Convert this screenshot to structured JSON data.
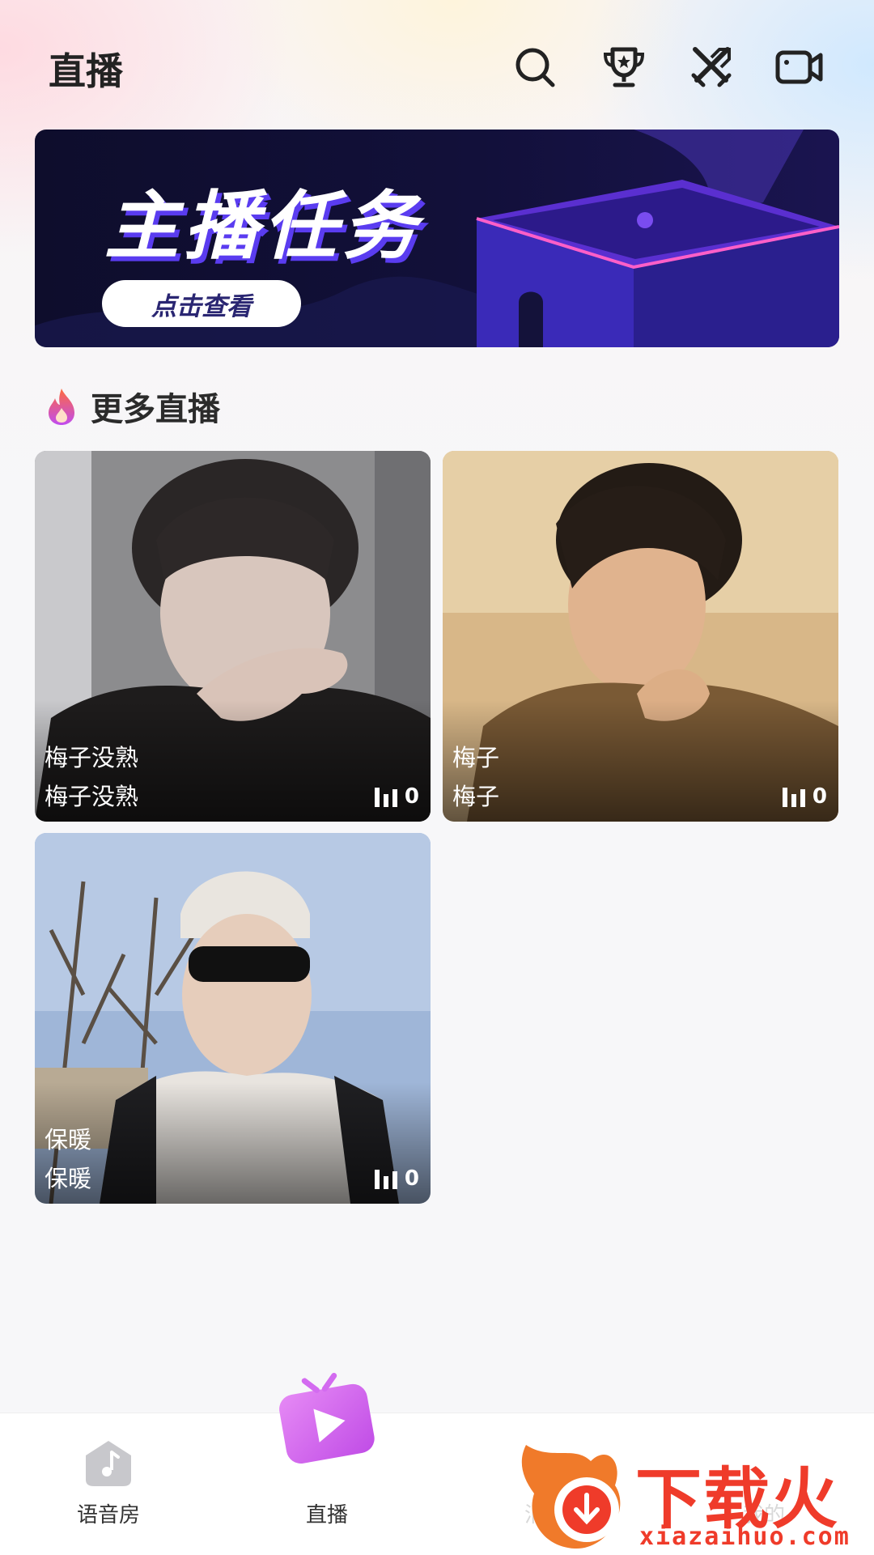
{
  "header": {
    "title": "直播",
    "icons": [
      "search-icon",
      "trophy-icon",
      "pk-swords-icon",
      "video-camera-icon"
    ]
  },
  "banner": {
    "title": "主播任务",
    "button_label": "点击查看"
  },
  "section": {
    "title": "更多直播",
    "icon": "flame-icon"
  },
  "cards": [
    {
      "name": "梅子没熟",
      "subtitle": "梅子没熟",
      "viewers": "0",
      "image": "person-photo-gray-tshirt"
    },
    {
      "name": "梅子",
      "subtitle": "梅子",
      "viewers": "0",
      "image": "person-photo-brown-shirt"
    },
    {
      "name": "保暖",
      "subtitle": "保暖",
      "viewers": "0",
      "image": "person-photo-cap-sunglasses"
    }
  ],
  "tabbar": {
    "tabs": [
      {
        "label": "语音房",
        "icon": "music-note-icon"
      },
      {
        "label": "直播",
        "icon": "tv-play-icon"
      },
      {
        "label": "消息",
        "icon": "message-icon"
      },
      {
        "label": "我的",
        "icon": "profile-icon"
      }
    ]
  },
  "watermark": {
    "text": "下载火",
    "url": "xiazaihuo.com"
  },
  "colors": {
    "accent": "#d86cf0",
    "banner_bg": "#12103a",
    "watermark": "#ef3b2a"
  }
}
